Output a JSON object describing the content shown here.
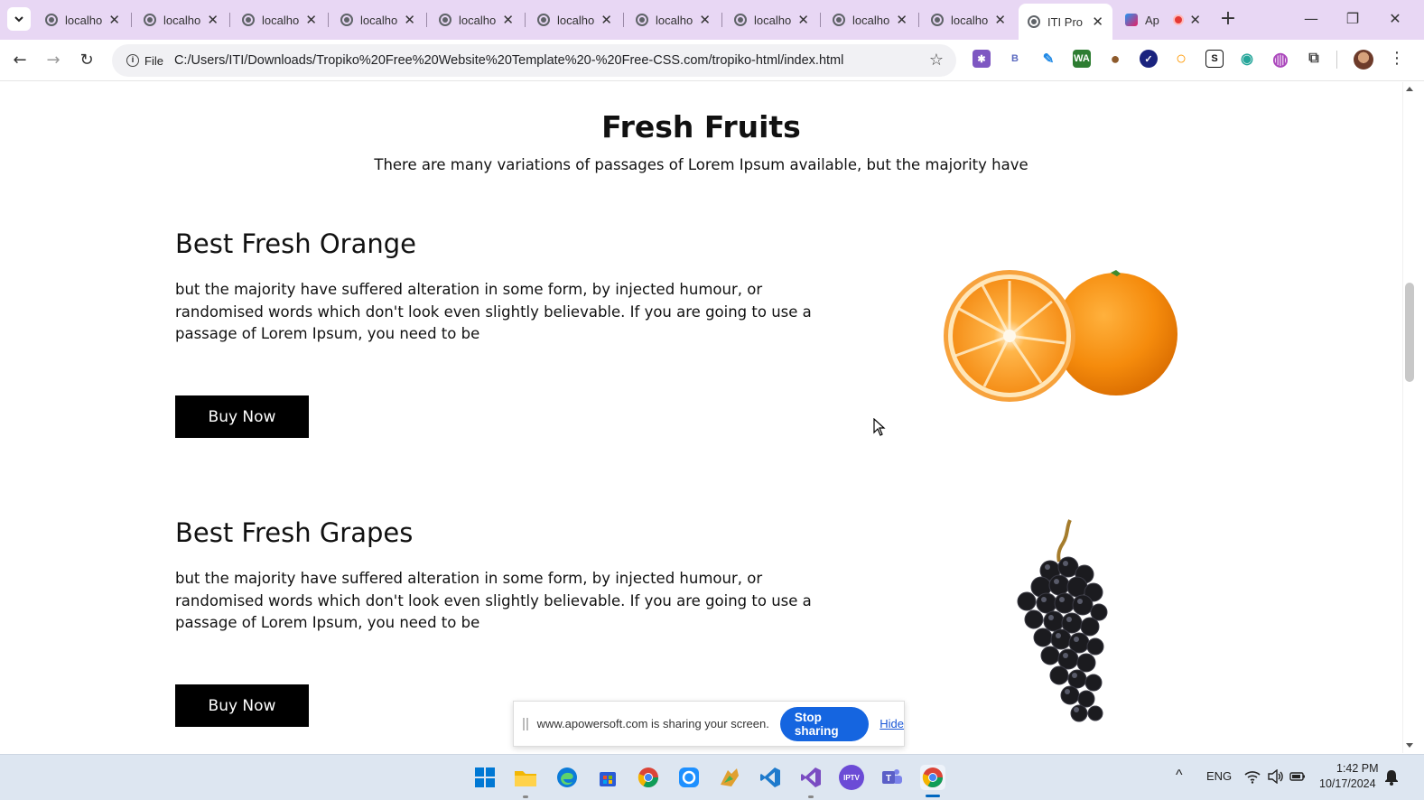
{
  "browser": {
    "tabs": [
      {
        "title": "localho",
        "active": false
      },
      {
        "title": "localho",
        "active": false
      },
      {
        "title": "localho",
        "active": false
      },
      {
        "title": "localho",
        "active": false
      },
      {
        "title": "localho",
        "active": false
      },
      {
        "title": "localho",
        "active": false
      },
      {
        "title": "localho",
        "active": false
      },
      {
        "title": "localho",
        "active": false
      },
      {
        "title": "localho",
        "active": false
      },
      {
        "title": "localho",
        "active": false
      },
      {
        "title": "ITI Pro",
        "active": true
      },
      {
        "title": "Ap",
        "active": false,
        "recording": true
      }
    ],
    "tab_close_glyph": "✕",
    "new_tab_glyph": "+",
    "window_controls": {
      "minimize": "—",
      "restore": "❐",
      "close": "✕"
    },
    "nav": {
      "back": "←",
      "forward": "→",
      "reload": "↻"
    },
    "omnibox": {
      "scheme_chip": "File",
      "url": "C:/Users/ITI/Downloads/Tropiko%20Free%20Website%20Template%20-%20Free-CSS.com/tropiko-html/index.html",
      "bookmark_glyph": "☆"
    },
    "extensions": [
      {
        "name": "gear-extension-icon",
        "glyph": "✱",
        "color": "#7e57c2"
      },
      {
        "name": "b-extension-icon",
        "glyph": "B",
        "color": "#5c6bc0"
      },
      {
        "name": "feather-extension-icon",
        "glyph": "✎",
        "color": "#1e88e5"
      },
      {
        "name": "wa-extension-icon",
        "glyph": "WA",
        "color": "#2e7d32"
      },
      {
        "name": "cookie-extension-icon",
        "glyph": "●",
        "color": "#8d5a2b"
      },
      {
        "name": "check-extension-icon",
        "glyph": "✓",
        "color": "#1a237e"
      },
      {
        "name": "ring-extension-icon",
        "glyph": "○",
        "color": "#ff9800"
      },
      {
        "name": "s-extension-icon",
        "glyph": "S",
        "color": "#111111"
      },
      {
        "name": "camera-extension-icon",
        "glyph": "◉",
        "color": "#26a69a"
      },
      {
        "name": "globe-extension-icon",
        "glyph": "◍",
        "color": "#ab47bc"
      },
      {
        "name": "puzzle-extension-icon",
        "glyph": "⧉",
        "color": "#444444"
      }
    ],
    "menu_glyph": "⋮"
  },
  "page": {
    "section_title": "Fresh Fruits",
    "section_subtitle": "There are many variations of passages of Lorem Ipsum available, but the majority have",
    "products": [
      {
        "name": "Best Fresh Orange",
        "description": "but the majority have suffered alteration in some form, by injected humour, or randomised words which don't look even slightly believable. If you are going to use a passage of Lorem Ipsum, you need to be",
        "button": "Buy Now",
        "image": "orange-image"
      },
      {
        "name": "Best Fresh Grapes",
        "description": "but the majority have suffered alteration in some form, by injected humour, or randomised words which don't look even slightly believable. If you are going to use a passage of Lorem Ipsum, you need to be",
        "button": "Buy Now",
        "image": "grapes-image"
      }
    ]
  },
  "screen_share": {
    "message": "www.apowersoft.com is sharing your screen.",
    "stop_label": "Stop sharing",
    "hide_label": "Hide"
  },
  "taskbar": {
    "apps": [
      {
        "name": "start-button",
        "glyph": "⊞",
        "color": "#0078d4"
      },
      {
        "name": "file-explorer-icon",
        "glyph": "▆",
        "color": "#f2b705"
      },
      {
        "name": "edge-icon",
        "glyph": "e",
        "color": "#0c7bd8"
      },
      {
        "name": "store-icon",
        "glyph": "▦",
        "color": "#2a5bd7"
      },
      {
        "name": "chrome-icon",
        "glyph": "◉",
        "color": "#e5412d"
      },
      {
        "name": "apowersoft-icon",
        "glyph": "⌂",
        "color": "#1e90ff"
      },
      {
        "name": "paint-icon",
        "glyph": "✎",
        "color": "#e0a030"
      },
      {
        "name": "vscode-icon",
        "glyph": "❮❯",
        "color": "#1e7acc"
      },
      {
        "name": "visual-studio-icon",
        "glyph": "∞",
        "color": "#7a4cc2"
      },
      {
        "name": "iptv-icon",
        "glyph": "TV",
        "color": "#6b4bd6"
      },
      {
        "name": "teams-icon",
        "glyph": "T",
        "color": "#5b5fc7"
      },
      {
        "name": "chrome-active-icon",
        "glyph": "◉",
        "color": "#e5412d"
      }
    ],
    "tray": {
      "chevron": "^",
      "language": "ENG",
      "wifi": "≋",
      "volume": "🔊",
      "battery": "▭",
      "time": "1:42 PM",
      "date": "10/17/2024",
      "notification": "🔔"
    }
  }
}
